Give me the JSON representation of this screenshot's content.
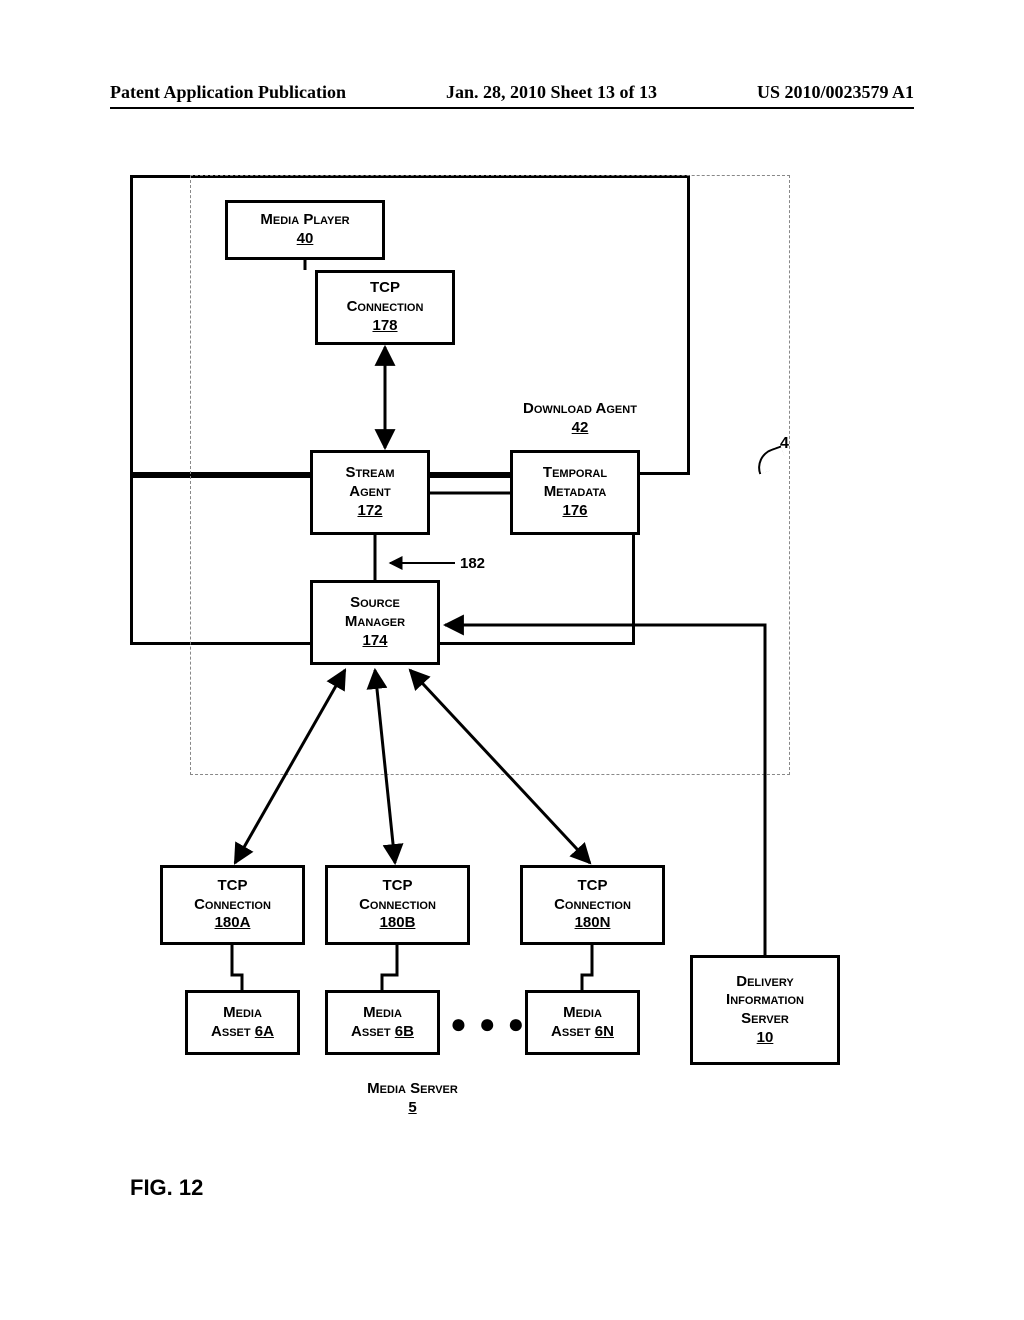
{
  "header": {
    "left": "Patent Application Publication",
    "center": "Jan. 28, 2010  Sheet 13 of 13",
    "right": "US 2010/0023579 A1"
  },
  "boxes": {
    "media_player": {
      "label": "Media Player",
      "ref": "40"
    },
    "tcp178": {
      "label1": "TCP",
      "label2": "Connection",
      "ref": "178"
    },
    "download_agent": {
      "label": "Download Agent",
      "ref": "42"
    },
    "stream_agent": {
      "label1": "Stream",
      "label2": "Agent",
      "ref": "172"
    },
    "temporal": {
      "label1": "Temporal",
      "label2": "Metadata",
      "ref": "176"
    },
    "source_mgr": {
      "label1": "Source",
      "label2": "Manager",
      "ref": "174"
    },
    "tcp180a": {
      "label1": "TCP",
      "label2": "Connection",
      "ref": "180A"
    },
    "tcp180b": {
      "label1": "TCP",
      "label2": "Connection",
      "ref": "180B"
    },
    "tcp180n": {
      "label1": "TCP",
      "label2": "Connection",
      "ref": "180N"
    },
    "media_server": {
      "label": "Media Server",
      "ref": "5"
    },
    "asset6a": {
      "label1": "Media",
      "label2": "Asset",
      "ref": "6A"
    },
    "asset6b": {
      "label1": "Media",
      "label2": "Asset",
      "ref": "6B"
    },
    "asset6n": {
      "label1": "Media",
      "label2": "Asset",
      "ref": "6N"
    },
    "delivery": {
      "label1": "Delivery",
      "label2": "Information",
      "label3": "Server",
      "ref": "10"
    }
  },
  "annotations": {
    "ref4": "4",
    "ref182": "182",
    "dots": "● ● ●"
  },
  "figure_label": "FIG. 12"
}
